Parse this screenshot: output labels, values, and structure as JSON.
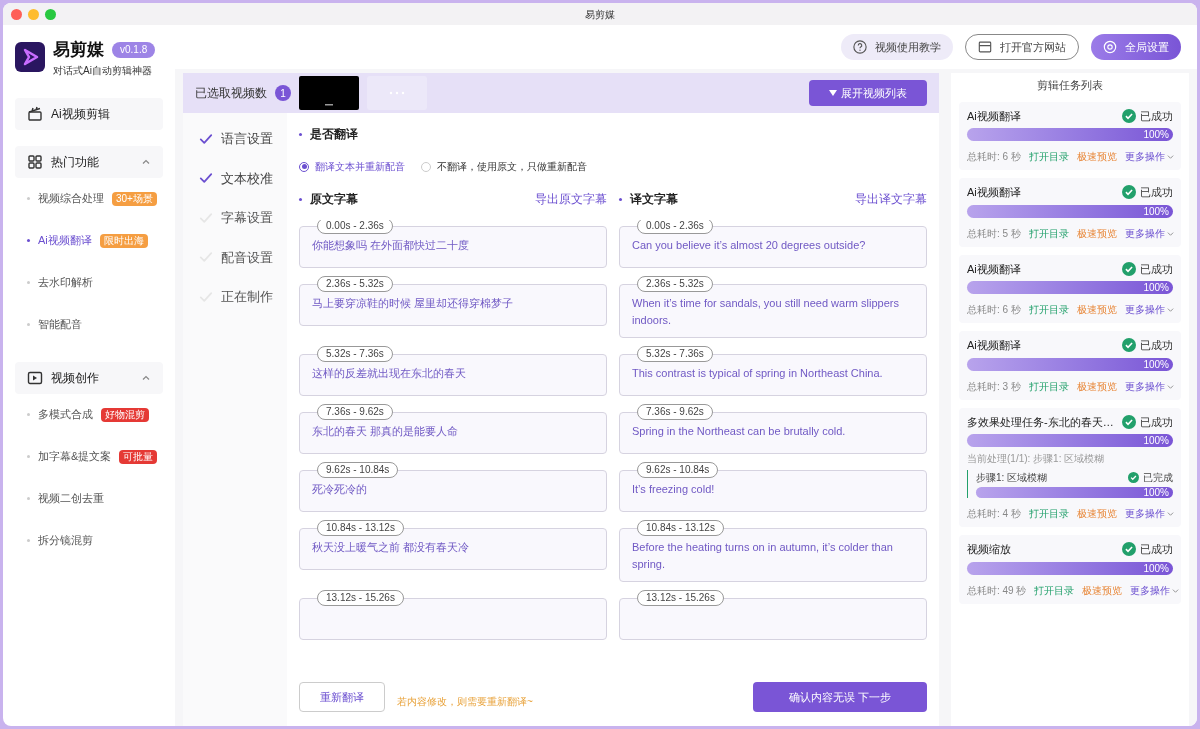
{
  "window": {
    "title": "易剪媒"
  },
  "app": {
    "name": "易剪媒",
    "version": "v0.1.8",
    "tagline": "对话式Ai自动剪辑神器"
  },
  "header_buttons": [
    {
      "kind": "help",
      "label": "视频使用教学"
    },
    {
      "kind": "web",
      "label": "打开官方网站"
    },
    {
      "kind": "settings",
      "label": "全局设置"
    }
  ],
  "sidebar": [
    {
      "kind": "main",
      "label": "Ai视频剪辑"
    },
    {
      "kind": "group",
      "label": "热门功能",
      "expanded": true,
      "children": [
        {
          "label": "视频综合处理",
          "badge": "30+场景",
          "color": "#f59e42",
          "selected": false
        },
        {
          "label": "Ai视频翻译",
          "badge": "限时出海",
          "color": "#f59e42",
          "selected": true
        },
        {
          "label": "去水印解析",
          "selected": false
        },
        {
          "label": "智能配音",
          "selected": false
        }
      ]
    },
    {
      "kind": "group",
      "label": "视频创作",
      "expanded": true,
      "children": [
        {
          "label": "多模式合成",
          "badge": "好物混剪",
          "color": "#e53935",
          "selected": false
        },
        {
          "label": "加字幕&提文案",
          "badge": "可批量",
          "color": "#e53935",
          "selected": false
        },
        {
          "label": "视频二创去重",
          "selected": false
        },
        {
          "label": "拆分镜混剪",
          "selected": false
        }
      ]
    }
  ],
  "selection_bar": {
    "label": "已选取视频数",
    "count": "1",
    "expand_button": "展开视频列表"
  },
  "steps": [
    {
      "label": "语言设置",
      "done": true
    },
    {
      "label": "文本校准",
      "done": true
    },
    {
      "label": "字幕设置",
      "done": false
    },
    {
      "label": "配音设置",
      "done": false
    },
    {
      "label": "正在制作",
      "done": false
    }
  ],
  "translate_section": {
    "title": "是否翻译",
    "options": [
      {
        "label": "翻译文本并重新配音",
        "selected": true
      },
      {
        "label": "不翻译，使用原文，只做重新配音",
        "selected": false
      }
    ]
  },
  "subtitles": {
    "original_title": "原文字幕",
    "original_export": "导出原文字幕",
    "translated_title": "译文字幕",
    "translated_export": "导出译文字幕",
    "rows": [
      {
        "original": {
          "time": "0.00s - 2.36s",
          "text": "你能想象吗 在外面都快过二十度"
        },
        "translated": {
          "time": "0.00s - 2.36s",
          "text": "Can you believe it’s almost 20 degrees outside?"
        }
      },
      {
        "original": {
          "time": "2.36s - 5.32s",
          "text": "马上要穿凉鞋的时候 屋里却还得穿棉梦子"
        },
        "translated": {
          "time": "2.36s - 5.32s",
          "text": "When it’s time for sandals, you still need warm slippers indoors."
        }
      },
      {
        "original": {
          "time": "5.32s - 7.36s",
          "text": "这样的反差就出现在东北的春天"
        },
        "translated": {
          "time": "5.32s - 7.36s",
          "text": "This contrast is typical of spring in Northeast China."
        }
      },
      {
        "original": {
          "time": "7.36s - 9.62s",
          "text": "东北的春天 那真的是能要人命"
        },
        "translated": {
          "time": "7.36s - 9.62s",
          "text": "Spring in the Northeast can be brutally cold."
        }
      },
      {
        "original": {
          "time": "9.62s - 10.84s",
          "text": "死冷死冷的"
        },
        "translated": {
          "time": "9.62s - 10.84s",
          "text": "It’s freezing cold!"
        }
      },
      {
        "original": {
          "time": "10.84s - 13.12s",
          "text": "秋天没上暖气之前 都没有春天冷"
        },
        "translated": {
          "time": "10.84s - 13.12s",
          "text": "Before the heating turns on in autumn, it’s colder than spring."
        }
      },
      {
        "original": {
          "time": "13.12s - 15.26s"
        },
        "translated": {
          "time": "13.12s - 15.26s"
        }
      }
    ]
  },
  "footer": {
    "retranslate": "重新翻译",
    "hint": "若内容修改，则需要重新翻译~",
    "confirm": "确认内容无误 下一步"
  },
  "task_list": {
    "title": "剪辑任务列表",
    "tasks": [
      {
        "name": "Ai视频翻译",
        "status": "已成功",
        "level": 1,
        "percent": "100%",
        "time": "总耗时: 6 秒",
        "actions": [
          "打开目录",
          "极速预览",
          "更多操作"
        ]
      },
      {
        "name": "Ai视频翻译",
        "status": "已成功",
        "level": 1,
        "percent": "100%",
        "time": "总耗时: 5 秒",
        "actions": [
          "打开目录",
          "极速预览",
          "更多操作"
        ]
      },
      {
        "name": "Ai视频翻译",
        "status": "已成功",
        "level": 1,
        "percent": "100%",
        "time": "总耗时: 6 秒",
        "actions": [
          "打开目录",
          "极速预览",
          "更多操作"
        ]
      },
      {
        "name": "Ai视频翻译",
        "status": "已成功",
        "level": 1,
        "percent": "100%",
        "time": "总耗时: 3 秒",
        "actions": [
          "打开目录",
          "极速预览",
          "更多操作"
        ]
      },
      {
        "name": "多效果处理任务-东北的春天…",
        "status": "已成功",
        "level": 1,
        "percent": "100%",
        "current": "当前处理(1/1): 步骤1:  区域模糊",
        "step": {
          "name": "步骤1:  区域模糊",
          "status": "已完成",
          "level": 1,
          "percent": "100%"
        },
        "time": "总耗时: 4 秒",
        "actions": [
          "打开目录",
          "极速预览",
          "更多操作"
        ]
      },
      {
        "name": "视频缩放",
        "status": "已成功",
        "level": 1,
        "percent": "100%",
        "time": "总耗时: 49 秒",
        "actions": [
          "打开目录",
          "极速预览",
          "更多操作"
        ]
      }
    ]
  }
}
